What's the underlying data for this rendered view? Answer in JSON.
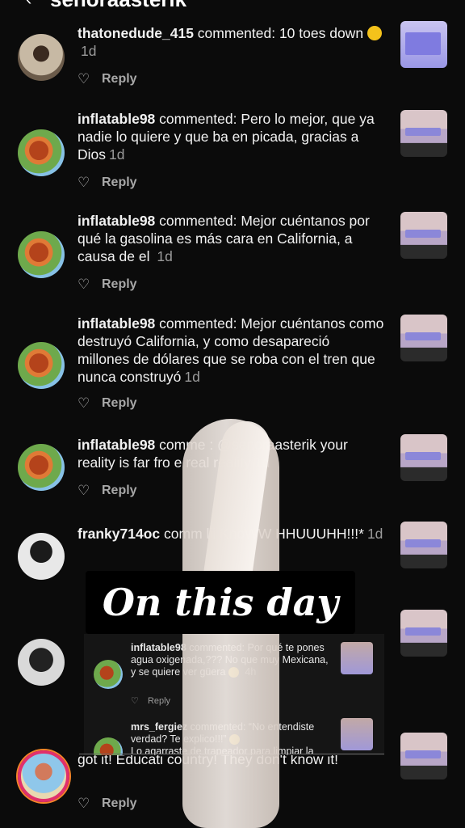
{
  "header": {
    "title": "senoraasterik"
  },
  "comments": [
    {
      "username": "thatonedude_415",
      "body": " commented: 10 toes down ",
      "time": "1d",
      "reply": "Reply"
    },
    {
      "username": "inflatable98",
      "body": " commented: Pero lo mejor, que ya nadie lo quiere y que ba en picada, gracias a Dios",
      "time": "1d",
      "reply": "Reply"
    },
    {
      "username": "inflatable98",
      "body": " commented: Mejor cuéntanos por qué la gasolina es más cara en California, a causa de el ",
      "time": "1d",
      "reply": "Reply"
    },
    {
      "username": "inflatable98",
      "body": " commented: Mejor cuéntanos como destruyó California, y como desapareció millones de dólares que se roba con el tren que nunca construyó",
      "time": "1d",
      "reply": "Reply"
    },
    {
      "username": "inflatable98",
      "body": " comme      : @senoraasterik your reality is far fro     e real reality",
      "time": "1d",
      "reply": "Reply"
    },
    {
      "username": "franky714oc",
      "body": " comm       lii KnoWW HHUUUHH!!!*",
      "time": "1d",
      "reply": ""
    },
    {
      "username": "",
      "body": "got it! Educati           country! They don't know it!",
      "time": "",
      "reply": "Reply"
    }
  ],
  "overlay": {
    "title": "On this day",
    "inner_comments": [
      {
        "username": "inflatable98",
        "body": " commented: Por qué te pones agua oxigenada,??? No que muy Mexicana, y se quiere ver güera",
        "time": "4h",
        "reply": "Reply"
      },
      {
        "username": "mrs_fergiez",
        "body": " commented: “No entendiste verdad? Te explico!!!” ",
        "time": "",
        "reply": ""
      },
      {
        "username": "",
        "body": "Lo agarraste de trapeador para limpiar la",
        "time": "",
        "reply": ""
      }
    ]
  },
  "icons": {
    "back": "chevron-left-icon",
    "like": "heart-outline-icon"
  },
  "colors": {
    "background": "#0b0b0b",
    "story_ring": "#e1306c",
    "thumb_chip": "#8b87d9"
  }
}
